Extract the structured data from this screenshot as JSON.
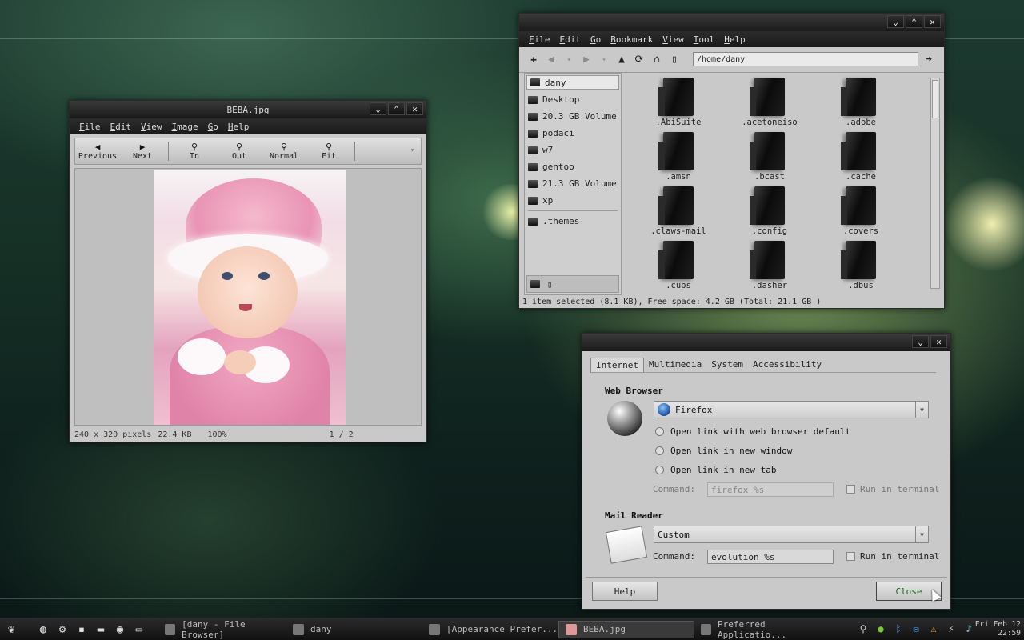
{
  "image_viewer": {
    "title": "BEBA.jpg",
    "menu": [
      "File",
      "Edit",
      "View",
      "Image",
      "Go",
      "Help"
    ],
    "toolbar": {
      "previous": "Previous",
      "next": "Next",
      "zoom_in": "In",
      "zoom_out": "Out",
      "normal": "Normal",
      "fit": "Fit"
    },
    "status": {
      "dimensions": "240 x 320 pixels",
      "size": "22.4 KB",
      "zoom": "100%",
      "position": "1 / 2"
    }
  },
  "file_browser": {
    "menu": [
      "File",
      "Edit",
      "Go",
      "Bookmark",
      "View",
      "Tool",
      "Help"
    ],
    "path": "/home/dany",
    "sidebar": [
      {
        "label": "dany",
        "selected": true
      },
      {
        "label": "Desktop"
      },
      {
        "label": "20.3 GB Volume"
      },
      {
        "label": "podaci"
      },
      {
        "label": "w7"
      },
      {
        "label": "gentoo"
      },
      {
        "label": "21.3 GB Volume"
      },
      {
        "label": "xp"
      },
      {
        "label": ".themes"
      }
    ],
    "files": [
      ".AbiSuite",
      ".acetoneiso",
      ".adobe",
      ".amsn",
      ".bcast",
      ".cache",
      ".claws-mail",
      ".config",
      ".covers",
      ".cups",
      ".dasher",
      ".dbus"
    ],
    "status": "1 item selected (8.1 KB), Free space: 4.2 GB (Total: 21.1 GB )"
  },
  "preferences": {
    "tabs": [
      "Internet",
      "Multimedia",
      "System",
      "Accessibility"
    ],
    "web_browser": {
      "title": "Web Browser",
      "selected": "Firefox",
      "options": [
        "Open link with web browser default",
        "Open link in new window",
        "Open link in new tab"
      ],
      "command_label": "Command:",
      "command_value": "firefox %s",
      "run_in_terminal": "Run in terminal"
    },
    "mail_reader": {
      "title": "Mail Reader",
      "selected": "Custom",
      "command_label": "Command:",
      "command_value": "evolution %s",
      "run_in_terminal": "Run in terminal"
    },
    "help_button": "Help",
    "close_button": "Close"
  },
  "taskbar": {
    "tasks": [
      "[dany - File Browser]",
      "dany",
      "[Appearance Prefer...",
      "BEBA.jpg",
      "Preferred Applicatio..."
    ],
    "clock_date": "Fri Feb 12",
    "clock_time": "22:59"
  }
}
